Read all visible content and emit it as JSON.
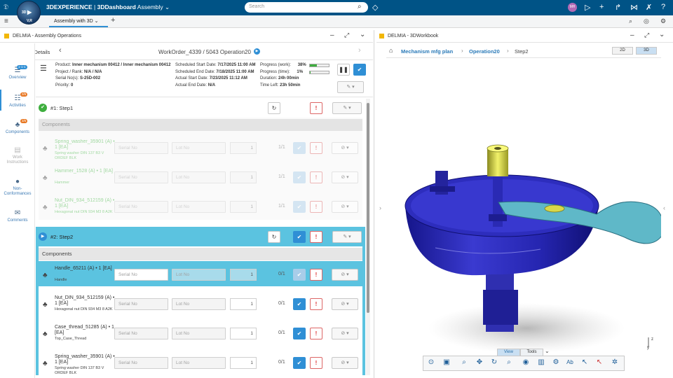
{
  "app": {
    "brand_bold": "3DEXPERIENCE",
    "brand_sep": " | ",
    "brand_dash": "3DDashboard",
    "brand_tab": "Assembly",
    "compass_top": "3D",
    "compass_play": "V,R"
  },
  "search": {
    "placeholder": "Search"
  },
  "user": {
    "initials": "MH"
  },
  "tabs": {
    "active": "Assembly with 3D"
  },
  "left_panel": {
    "title": "DELMIA - Assembly Operations"
  },
  "right_panel": {
    "title": "DELMIA - 3DWorkbook"
  },
  "sidebar": {
    "items": [
      {
        "label": "Overview",
        "badge": "1-1-1"
      },
      {
        "label": "Activities",
        "badge": "3/6"
      },
      {
        "label": "Components",
        "badge": "3/6"
      },
      {
        "label": "Work Instructions",
        "badge": ""
      },
      {
        "label": "Non-Conformances",
        "badge": ""
      },
      {
        "label": "Comments",
        "badge": ""
      }
    ]
  },
  "task": {
    "crumb": "Task Details",
    "workorder": "WorkOrder_4339 / 5043 Operation20"
  },
  "info": {
    "product_label": "Product:",
    "product_value": "Inner mechanism 00412 / Inner mechanism 00412",
    "rank_label": "Project / Rank:",
    "rank_value": "N/A / N/A",
    "serial_label": "Serial No(s):",
    "serial_value": "S-25D-002",
    "priority_label": "Priority:",
    "priority_value": "0",
    "sched_start_label": "Scheduled Start Date:",
    "sched_start_value": "7/17/2025 11:00 AM",
    "sched_end_label": "Scheduled End Date:",
    "sched_end_value": "7/18/2025 11:00 AM",
    "actual_start_label": "Actual Start Date:",
    "actual_start_value": "7/23/2025 11:12 AM",
    "actual_end_label": "Actual End Date:",
    "actual_end_value": "N/A",
    "prog_work_label": "Progress (work):",
    "prog_work_value": "38%",
    "prog_work": 0.38,
    "prog_time_label": "Progress (time):",
    "prog_time_value": "1%",
    "prog_time": 0.01,
    "duration_label": "Duration:",
    "duration_value": "24h 00min",
    "timeleft_label": "Time Left:",
    "timeleft_value": "23h 50min"
  },
  "step1": {
    "title": "#1: Step1",
    "components_header": "Components",
    "rows": [
      {
        "name": "Spring_washer_35901 (A) • 1 [EA]",
        "desc": "Spring washer DIN 137 B3 V ORDEF BLK",
        "serial": "Serial No",
        "lot": "Lot No",
        "qty": "1",
        "count": "1/1"
      },
      {
        "name": "Hammer_1528 (A) • 1 [EA]",
        "desc": "Hammer",
        "serial": "Serial No",
        "lot": "Lot No",
        "qty": "1",
        "count": "1/1"
      },
      {
        "name": "Nut_DIN_934_512159 (A) • 1 [EA]",
        "desc": "Hexagonal nut DIN 934 M3 8 A2K",
        "serial": "Serial No",
        "lot": "Lot No",
        "qty": "1",
        "count": "1/1"
      }
    ]
  },
  "step2": {
    "title": "#2: Step2",
    "components_header": "Components",
    "rows": [
      {
        "name": "Handle_65211 (A) • 1 [EA]",
        "desc": "Handle",
        "serial": "Serial No",
        "lot": "Lot No",
        "qty": "1",
        "count": "0/1"
      },
      {
        "name": "Nut_DIN_934_512159 (A) • 1 [EA]",
        "desc": "Hexagonal nut DIN 934 M3 8 A2K",
        "serial": "Serial No",
        "lot": "Lot No",
        "qty": "1",
        "count": "0/1"
      },
      {
        "name": "Case_thread_51285 (A) • 1 [EA]",
        "desc": "Top_Case_Thread",
        "serial": "Serial No",
        "lot": "Lot No",
        "qty": "1",
        "count": "0/1"
      },
      {
        "name": "Spring_washer_35901 (A) • 1 [EA]",
        "desc": "Spring washer DIN 137 B3 V ORDEF BLK",
        "serial": "Serial No",
        "lot": "Lot No",
        "qty": "1",
        "count": "0/1"
      }
    ]
  },
  "workbook": {
    "crumb1": "Mechanism mfg plan",
    "crumb2": "Operation20",
    "crumb3": "Step2",
    "mode_2d": "2D",
    "mode_3d": "3D",
    "view_tab": "View",
    "tools_tab": "Tools",
    "axis_y": "y",
    "axis_z": "z"
  },
  "colors": {
    "topbar": "#005386",
    "accent": "#2f8fd5",
    "step_active": "#5bc3e0",
    "model": "#2a2aa8",
    "handle": "#5fb8c8"
  }
}
